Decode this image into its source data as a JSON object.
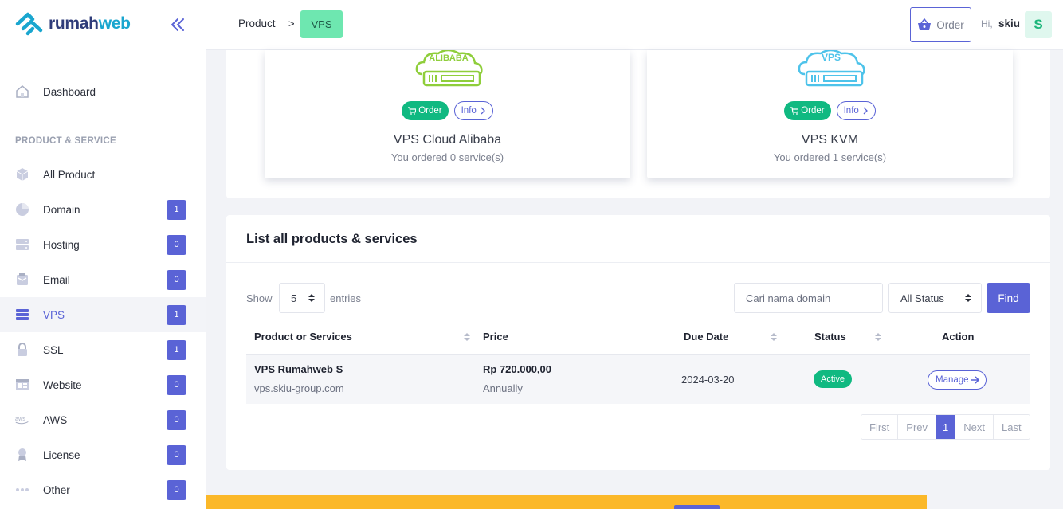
{
  "brand": {
    "name_part1": "rumah",
    "name_part2": "web"
  },
  "sidebar": {
    "dashboard": "Dashboard",
    "section_title": "PRODUCT & SERVICE",
    "items": [
      {
        "label": "All Product",
        "icon": "cube-icon",
        "badge": null
      },
      {
        "label": "Domain",
        "icon": "globe-icon",
        "badge": "1"
      },
      {
        "label": "Hosting",
        "icon": "server-icon",
        "badge": "0"
      },
      {
        "label": "Email",
        "icon": "envelope-icon",
        "badge": "0"
      },
      {
        "label": "VPS",
        "icon": "vps-icon",
        "badge": "1"
      },
      {
        "label": "SSL",
        "icon": "lock-icon",
        "badge": "1"
      },
      {
        "label": "Website",
        "icon": "browser-icon",
        "badge": "0"
      },
      {
        "label": "AWS",
        "icon": "aws-icon",
        "badge": "0"
      },
      {
        "label": "License",
        "icon": "award-icon",
        "badge": "0"
      },
      {
        "label": "Other",
        "icon": "dots-icon",
        "badge": "0"
      }
    ]
  },
  "topbar": {
    "breadcrumb_product": "Product",
    "breadcrumb_sep": ">",
    "breadcrumb_current": "VPS",
    "order_label": "Order",
    "hi": "Hi,",
    "username": "skiu",
    "avatar_letter": "S"
  },
  "products": [
    {
      "title": "VPS Cloud Alibaba",
      "subtitle": "You ordered 0 service(s)",
      "order_label": "Order",
      "info_label": "Info",
      "image_text": "ALIBABA"
    },
    {
      "title": "VPS KVM",
      "subtitle": "You ordered 1 service(s)",
      "order_label": "Order",
      "info_label": "Info",
      "image_text": "VPS"
    }
  ],
  "list": {
    "title": "List all products & services",
    "show_label": "Show",
    "show_value": "5",
    "entries_label": "entries",
    "search_placeholder": "Cari nama domain",
    "status_filter": "All Status",
    "find_label": "Find",
    "columns": [
      "Product or Services",
      "Price",
      "Due Date",
      "Status",
      "Action"
    ],
    "rows": [
      {
        "product": "VPS Rumahweb S",
        "domain": "vps.skiu-group.com",
        "price": "Rp 720.000,00",
        "cycle": "Annually",
        "due_date": "2024-03-20",
        "status": "Active",
        "action": "Manage"
      }
    ],
    "pagination": [
      "First",
      "Prev",
      "1",
      "Next",
      "Last"
    ]
  },
  "colors": {
    "accent": "#5a63d6",
    "success": "#10b981",
    "breadcrumb_active": "#6ee7b0",
    "alibaba_green": "#8fce3b",
    "kvm_blue": "#4ec3ea",
    "footer_banner": "#fbb829"
  }
}
